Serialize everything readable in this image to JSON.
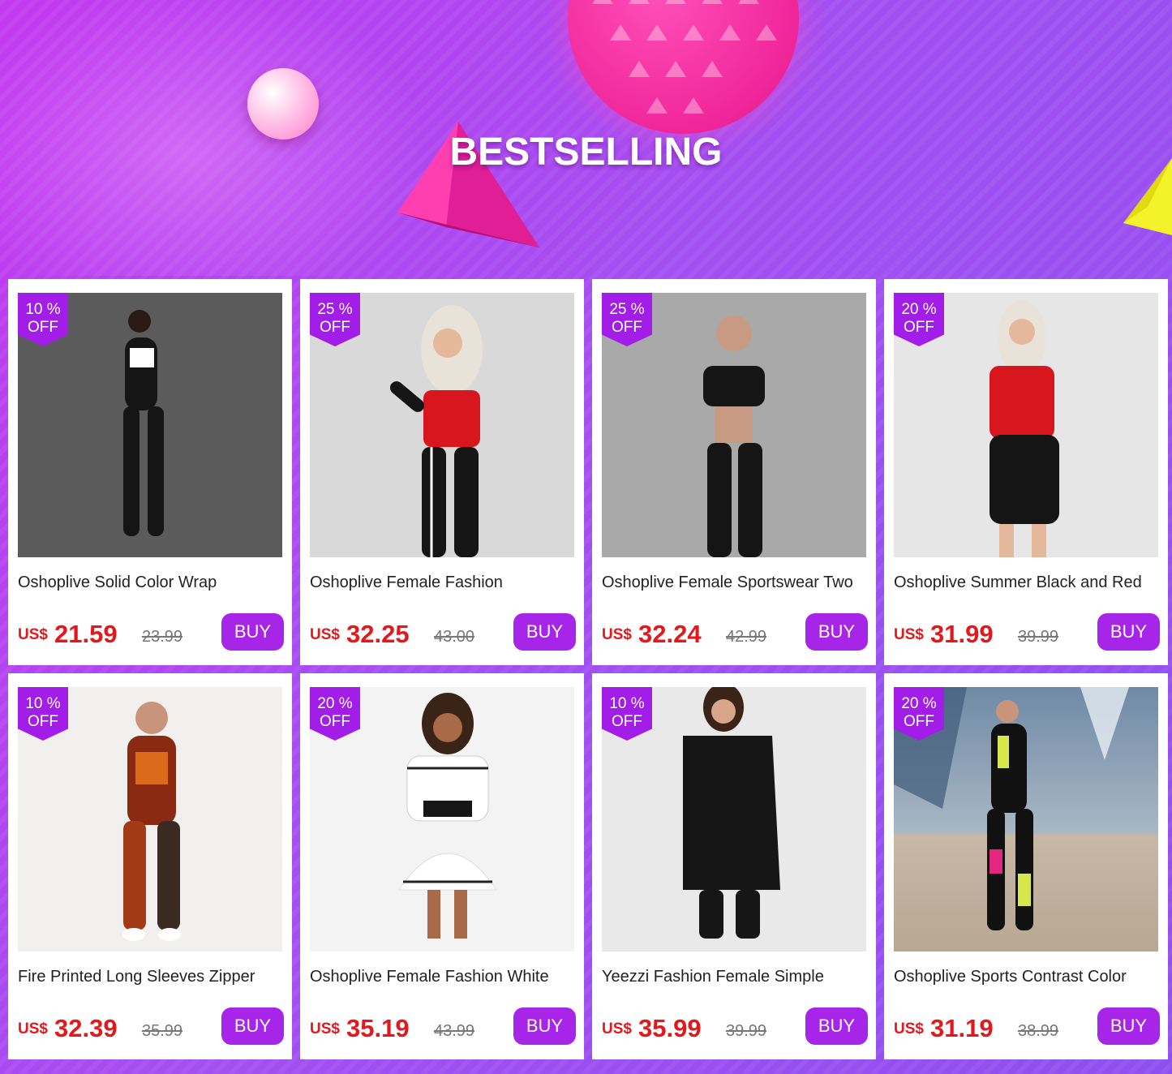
{
  "banner": {
    "title": "BESTSELLING"
  },
  "colors": {
    "accent": "#a724e9",
    "price": "#e4181c",
    "badge": "#a21ee8"
  },
  "products": [
    {
      "name": "Oshoplive Solid Color Wrap",
      "discount_pct": "10 %",
      "discount_off": "OFF",
      "currency": "US$",
      "price": "21.59",
      "old_price": "23.99",
      "buy_label": "BUY",
      "bg": "#5b5b5b",
      "outfit": "#111111",
      "accent": "#ffffff"
    },
    {
      "name": "Oshoplive Female Fashion",
      "discount_pct": "25 %",
      "discount_off": "OFF",
      "currency": "US$",
      "price": "32.25",
      "old_price": "43.00",
      "buy_label": "BUY",
      "bg": "#d9d9d9",
      "outfit": "#151515",
      "accent": "#d8161e"
    },
    {
      "name": "Oshoplive Female Sportswear Two",
      "discount_pct": "25 %",
      "discount_off": "OFF",
      "currency": "US$",
      "price": "32.24",
      "old_price": "42.99",
      "buy_label": "BUY",
      "bg": "#a9a9a9",
      "outfit": "#151515",
      "accent": "#c89a82"
    },
    {
      "name": "Oshoplive Summer Black and Red",
      "discount_pct": "20 %",
      "discount_off": "OFF",
      "currency": "US$",
      "price": "31.99",
      "old_price": "39.99",
      "buy_label": "BUY",
      "bg": "#e6e6e6",
      "outfit": "#151515",
      "accent": "#d8161e"
    },
    {
      "name": "Fire Printed Long Sleeves Zipper",
      "discount_pct": "10 %",
      "discount_off": "OFF",
      "currency": "US$",
      "price": "32.39",
      "old_price": "35.99",
      "buy_label": "BUY",
      "bg": "#f1f0ee",
      "outfit": "#8a2a12",
      "accent": "#f07a1e"
    },
    {
      "name": "Oshoplive Female Fashion White",
      "discount_pct": "20 %",
      "discount_off": "OFF",
      "currency": "US$",
      "price": "35.19",
      "old_price": "43.99",
      "buy_label": "BUY",
      "bg": "#f3f3f3",
      "outfit": "#ffffff",
      "accent": "#222222"
    },
    {
      "name": "Yeezzi Fashion Female Simple",
      "discount_pct": "10 %",
      "discount_off": "OFF",
      "currency": "US$",
      "price": "35.99",
      "old_price": "39.99",
      "buy_label": "BUY",
      "bg": "#e9e9e9",
      "outfit": "#161616",
      "accent": "#2a2a2a"
    },
    {
      "name": "Oshoplive Sports Contrast Color",
      "discount_pct": "20 %",
      "discount_off": "OFF",
      "currency": "US$",
      "price": "31.19",
      "old_price": "38.99",
      "buy_label": "BUY",
      "bg": "#9aa7b3",
      "outfit": "#111111",
      "accent": "#d7e64a"
    }
  ]
}
